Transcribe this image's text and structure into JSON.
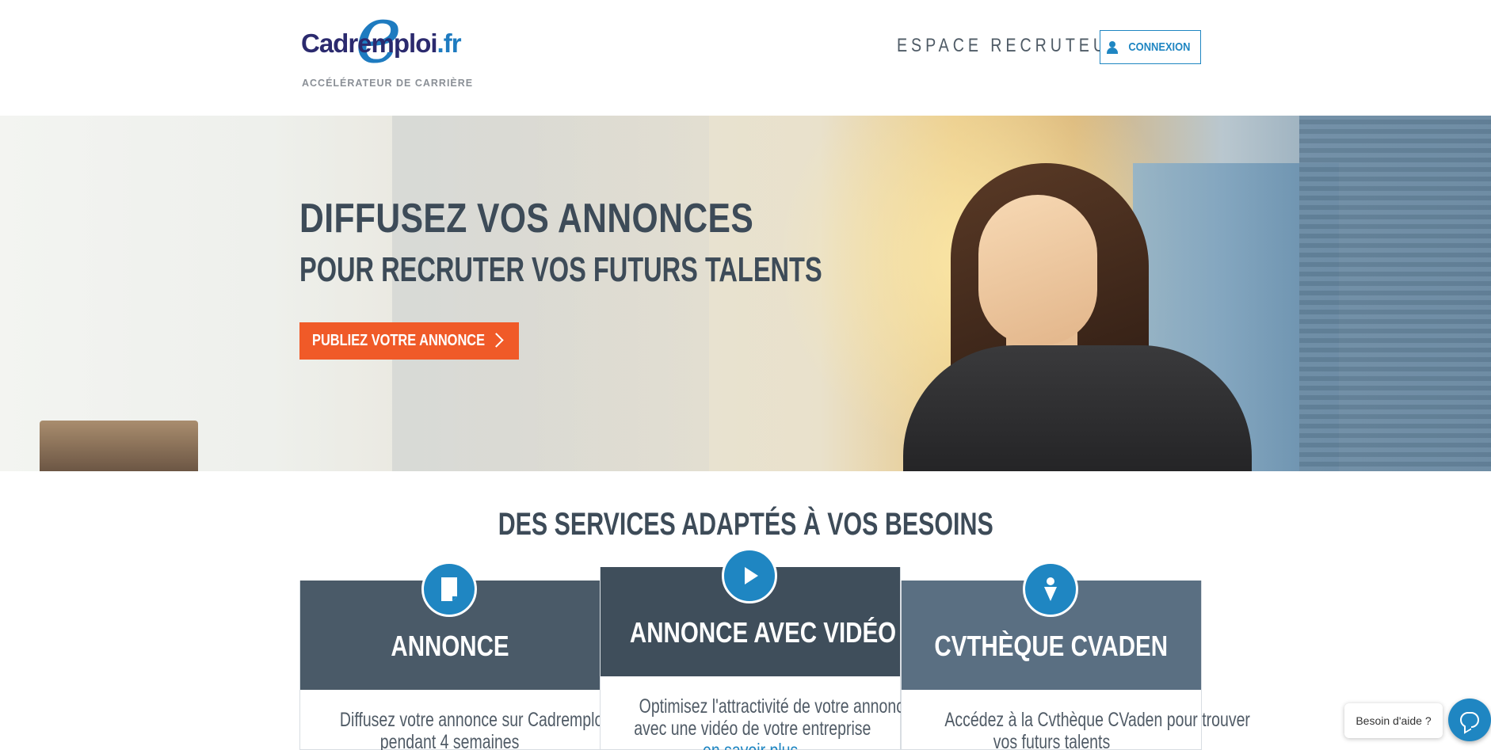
{
  "header": {
    "logo": {
      "brand_main": "Cadremploi",
      "brand_tld": ".fr",
      "tagline": "ACCÉLÉRATEUR DE CARRIÈRE"
    },
    "espace_recruteur": "ESPACE RECRUTEUR",
    "connexion_label": "CONNEXION"
  },
  "hero": {
    "title": "DIFFUSEZ VOS ANNONCES",
    "subtitle": "POUR RECRUTER VOS FUTURS TALENTS",
    "cta_label": "PUBLIEZ VOTRE ANNONCE"
  },
  "services": {
    "title": "DES SERVICES ADAPTÉS À VOS BESOINS",
    "cards": [
      {
        "icon": "document-icon",
        "title": "ANNONCE",
        "desc_line1": "Diffusez votre annonce sur Cadremploi.fr",
        "desc_line2": "pendant 4 semaines"
      },
      {
        "icon": "play-icon",
        "title": "ANNONCE AVEC VIDÉO",
        "desc_line1": "Optimisez l'attractivité de votre annonce",
        "desc_line2": "avec une vidéo de votre entreprise",
        "more": "en savoir plus"
      },
      {
        "icon": "person-pin-icon",
        "title": "CVTHÈQUE CVADEN",
        "desc_line1": "Accédez à la Cvthèque CVaden pour trouver",
        "desc_line2": "vos futurs talents"
      }
    ]
  },
  "chat": {
    "help_label": "Besoin d'aide ?"
  },
  "colors": {
    "accent": "#f05a28",
    "brand_blue": "#1f86c2",
    "brand_navy": "#2b2a6e",
    "slate": "#3d4b58"
  }
}
